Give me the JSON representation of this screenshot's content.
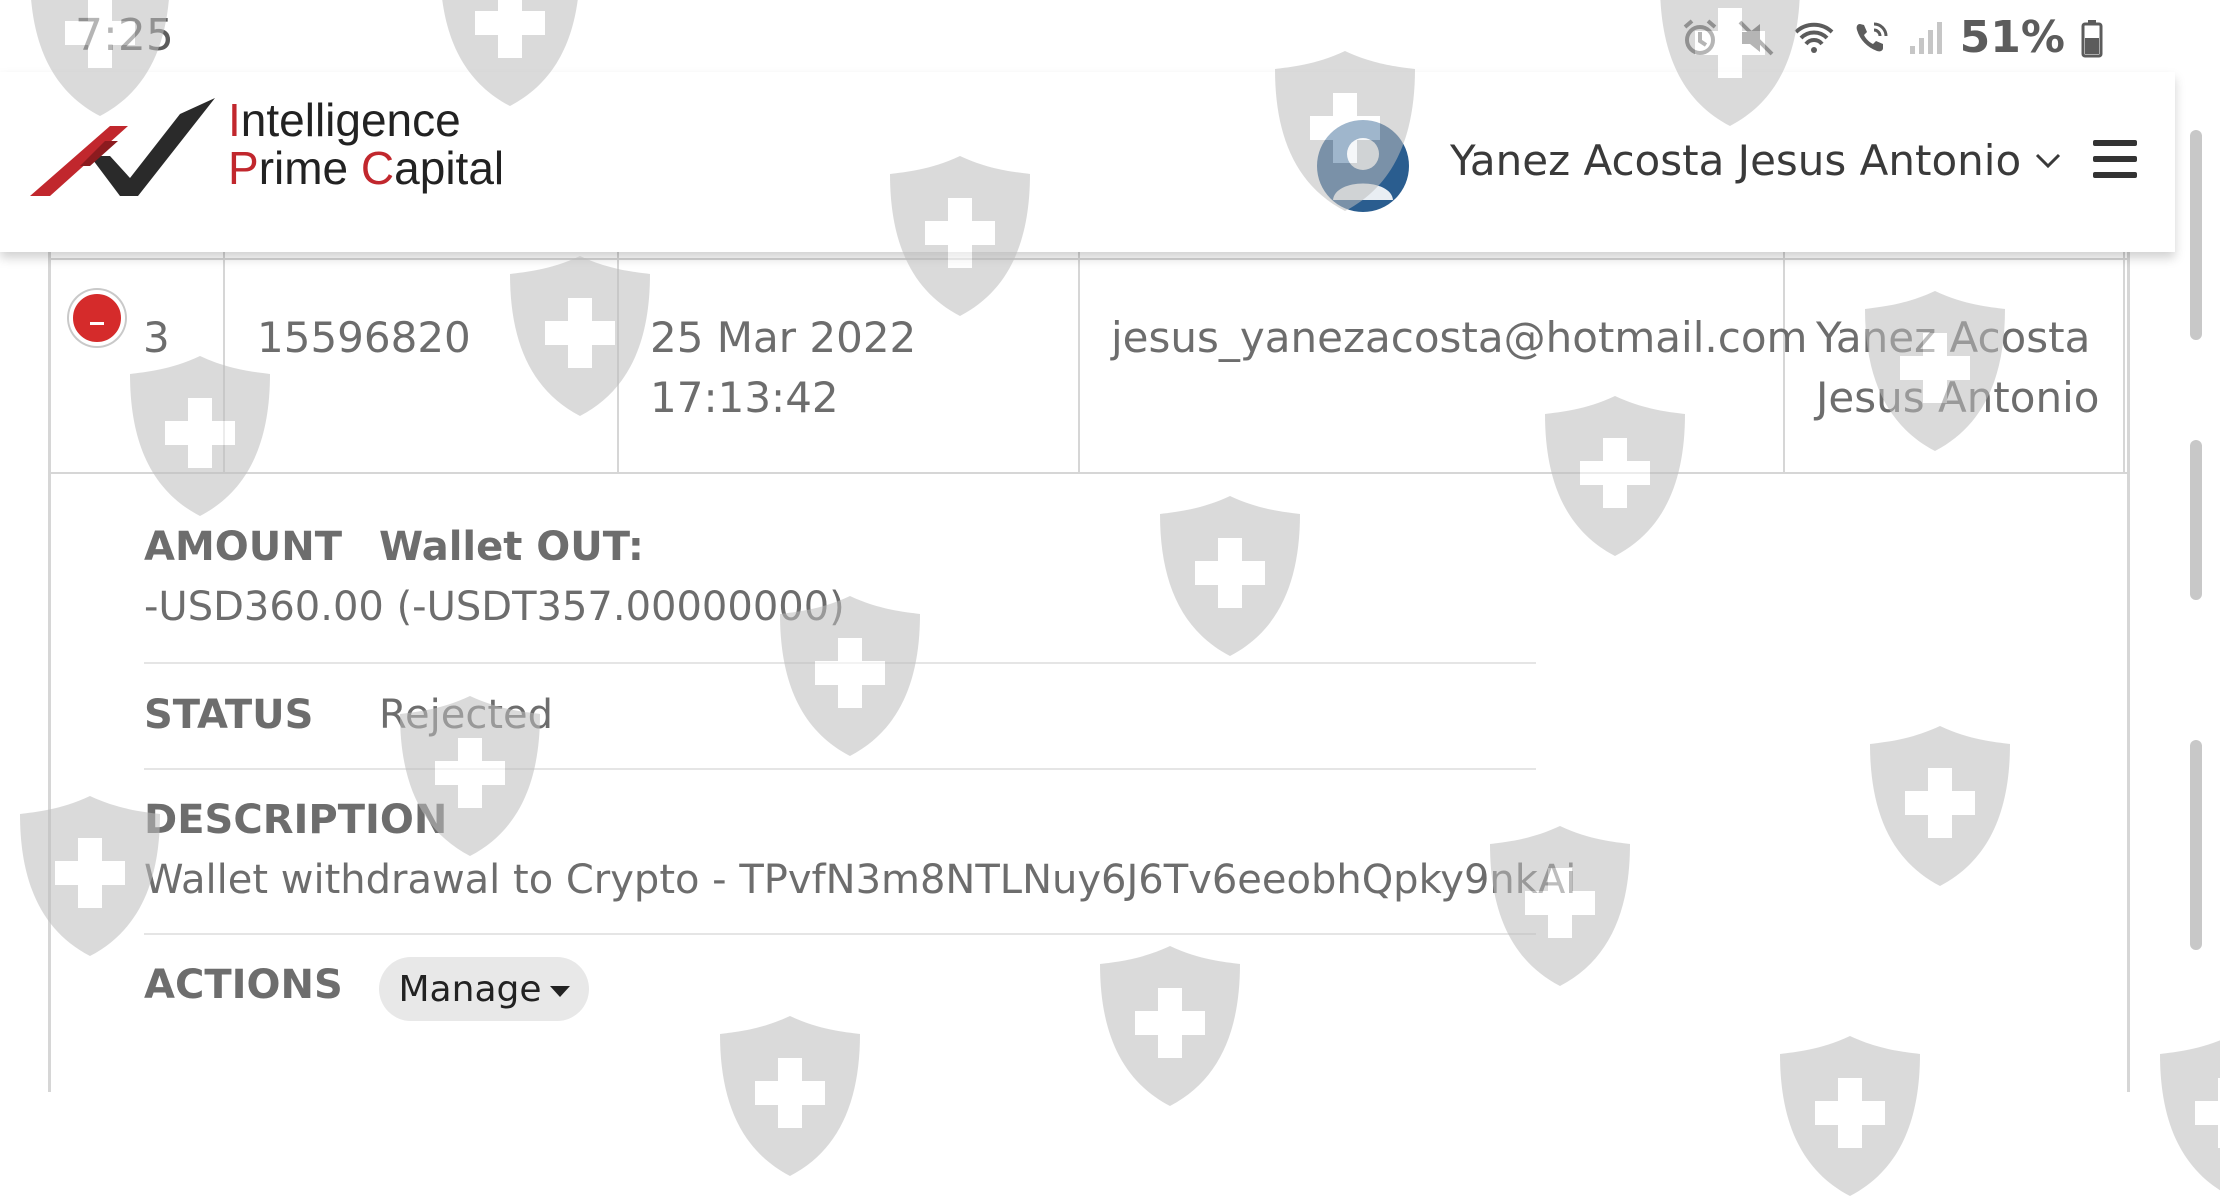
{
  "status_bar": {
    "time": "7:25",
    "battery": "51%",
    "icons": [
      "alarm-icon",
      "mute-icon",
      "wifi-icon",
      "wifi-call-icon",
      "signal-icon",
      "battery-icon"
    ]
  },
  "header": {
    "logo_line1_first": "I",
    "logo_line1_rest": "ntelligence",
    "logo_line2_p": "P",
    "logo_line2_rime": "rime ",
    "logo_line2_c": "C",
    "logo_line2_apital": "apital",
    "user_name": "Yanez Acosta Jesus Antonio",
    "brand_red": "#c1272d"
  },
  "row": {
    "number": "3",
    "id": "15596820",
    "date": "25 Mar 2022",
    "time": "17:13:42",
    "email": "jesus_yanezacosta@hotmail.com",
    "name_line1": "Yanez Acosta",
    "name_line2": "Jesus Antonio"
  },
  "details": {
    "amount_label": "AMOUNT",
    "wallet_label": "Wallet OUT:",
    "amount_value": "-USD360.00 (-USDT357.00000000)",
    "status_label": "STATUS",
    "status_value": "Rejected",
    "description_label": "DESCRIPTION",
    "description_value": "Wallet withdrawal to Crypto - TPvfN3m8NTLNuy6J6Tv6eeobhQpky9nkAi",
    "actions_label": "ACTIONS",
    "manage_label": "Manage"
  }
}
